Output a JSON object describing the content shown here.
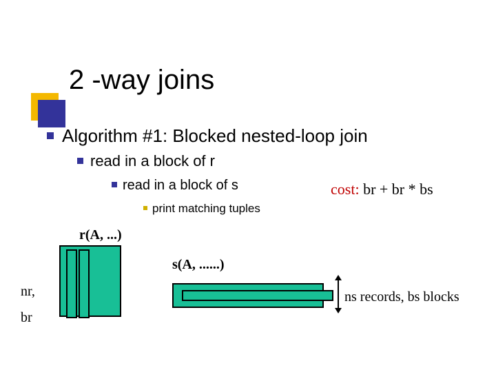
{
  "title": "2 -way joins",
  "bullets": {
    "lvl1": "Algorithm #1: Blocked nested-loop join",
    "lvl2": "read in a block of r",
    "lvl3": "read in a block of s",
    "lvl4": "print matching tuples"
  },
  "cost": {
    "label": "cost:",
    "expr": " br + br * bs"
  },
  "labels": {
    "r": "r(A, ...)",
    "s": "s(A, ......)",
    "nr": "nr,",
    "br": "br",
    "ns": "ns records, bs blocks"
  }
}
